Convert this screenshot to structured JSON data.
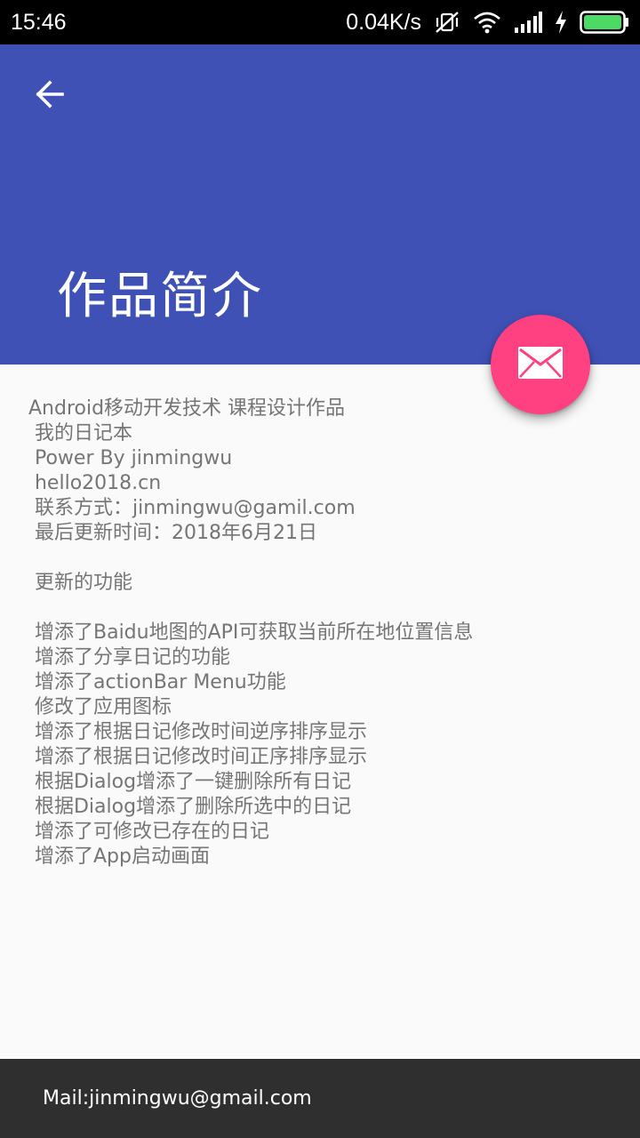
{
  "status_bar": {
    "time": "15:46",
    "net_speed": "0.04K/s",
    "icons": [
      "mute-vibrate-icon",
      "wifi-icon",
      "signal-icon",
      "charging-icon",
      "battery-icon"
    ],
    "battery_color": "#4cd964"
  },
  "app_bar": {
    "background": "#3f51b5",
    "back_icon": "arrow-left-icon",
    "title": "作品简介"
  },
  "fab": {
    "color": "#ff4081",
    "icon": "mail-icon"
  },
  "content": {
    "lines": [
      "Android移动开发技术 课程设计作品",
      " 我的日记本",
      " Power By jinmingwu",
      " hello2018.cn",
      " 联系方式：jinmingwu@gamil.com",
      " 最后更新时间：2018年6月21日",
      "",
      " 更新的功能",
      "",
      " 增添了Baidu地图的API可获取当前所在地位置信息",
      " 增添了分享日记的功能",
      " 增添了actionBar Menu功能",
      " 修改了应用图标",
      " 增添了根据日记修改时间逆序排序显示",
      " 增添了根据日记修改时间正序排序显示",
      " 根据Dialog增添了一键删除所有日记",
      " 根据Dialog增添了删除所选中的日记",
      " 增添了可修改已存在的日记",
      " 增添了App启动画面"
    ]
  },
  "footer": {
    "text": "Mail:jinmingwu@gmail.com"
  }
}
